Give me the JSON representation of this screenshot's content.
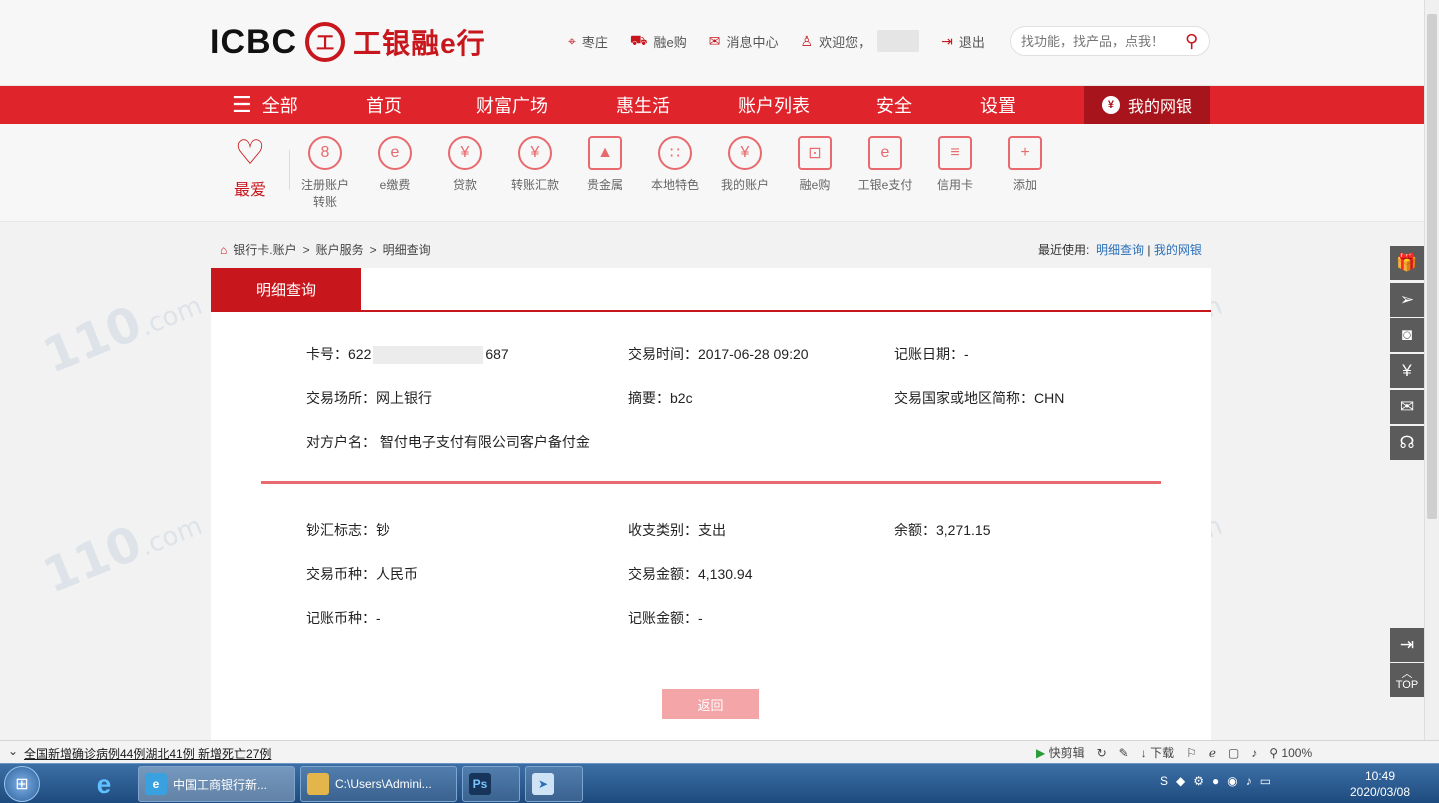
{
  "header": {
    "logo_en": "ICBC",
    "logo_badge": "工",
    "logo_cn": "工银融e行",
    "links": {
      "location": "枣庄",
      "shop": "融e购",
      "messages": "消息中心",
      "welcome": "欢迎您，",
      "logout": "退出"
    },
    "search_placeholder": "找功能，找产品，点我！"
  },
  "nav": {
    "all": "全部",
    "items": [
      "首页",
      "财富广场",
      "惠生活",
      "账户列表",
      "安全",
      "设置"
    ],
    "my_bank": "我的网银"
  },
  "quick": {
    "fav": "最爱",
    "items": [
      {
        "label": "注册账户转账",
        "icon": "8"
      },
      {
        "label": "e缴费",
        "icon": "e"
      },
      {
        "label": "贷款",
        "icon": "¥"
      },
      {
        "label": "转账汇款",
        "icon": "¥"
      },
      {
        "label": "贵金属",
        "icon": "▲"
      },
      {
        "label": "本地特色",
        "icon": "∷"
      },
      {
        "label": "我的账户",
        "icon": "¥"
      },
      {
        "label": "融e购",
        "icon": "⊡"
      },
      {
        "label": "工银e支付",
        "icon": "e"
      },
      {
        "label": "信用卡",
        "icon": "≡"
      },
      {
        "label": "添加",
        "icon": "+"
      }
    ]
  },
  "breadcrumb": {
    "path": [
      "银行卡.账户",
      ">",
      "账户服务",
      ">",
      "明细查询"
    ],
    "recent_label": "最近使用:",
    "recent_links": [
      "明细查询",
      "我的网银"
    ]
  },
  "panel": {
    "tab": "明细查询",
    "card_prefix": "卡号：622",
    "card_suffix": "687",
    "trade_time": "交易时间：2017-06-28 09:20",
    "post_date": "记账日期：-",
    "place": "交易场所：网上银行",
    "summary": "摘要：b2c",
    "country": "交易国家或地区简称：CHN",
    "counterparty": "对方户名： 智付电子支付有限公司客户备付金",
    "cash_flag": "钞汇标志：钞",
    "direction": "收支类别：支出",
    "balance": "余额：3,271.15",
    "currency": "交易币种：人民币",
    "amount": "交易金额：4,130.94",
    "post_currency": "记账币种：-",
    "post_amount": "记账金额：-",
    "back_button": "返回"
  },
  "side": {
    "icons": [
      "gift-icon",
      "paper-plane-icon",
      "camera-icon",
      "calendar-yuan-icon",
      "mail-icon",
      "headset-icon"
    ],
    "top_label": "TOP"
  },
  "status_bar": {
    "news": "全国新增确诊病例44例湖北41例 新增死亡27例",
    "clip": "快剪辑",
    "download": "下载",
    "zoom": "100%"
  },
  "taskbar": {
    "windows": [
      "中国工商银行新...",
      "C:\\Users\\Admini..."
    ],
    "time": "10:49",
    "date": "2020/03/08"
  },
  "watermark": "110",
  "watermark_suffix": ".com",
  "colors": {
    "brand_red": "#c8161d",
    "nav_red": "#e0242b",
    "link_blue": "#2a6fb8"
  }
}
